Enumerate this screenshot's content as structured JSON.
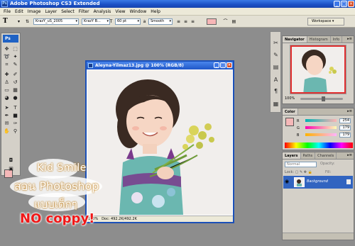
{
  "app": {
    "title": "Adobe Photoshop CS3 Extended",
    "logo": "Ps"
  },
  "menu": [
    "File",
    "Edit",
    "Image",
    "Layer",
    "Select",
    "Filter",
    "Analysis",
    "View",
    "Window",
    "Help"
  ],
  "options": {
    "tool_glyph": "T",
    "font_family": "KrazY_uS_2005",
    "font_style": "KrazY B...",
    "font_size": "60 pt",
    "antialias": "Smooth",
    "text_color": "#f7b6b6",
    "workspace_label": "Workspace"
  },
  "toolbox": {
    "badge": "Ps",
    "fg_color": "#f5b8b8"
  },
  "document": {
    "title": "Aleyna-Yilmaz13.jpg @ 100% (RGB/8)",
    "zoom": "100%",
    "doc_size": "Doc: 492.2K/492.2K"
  },
  "navigator": {
    "tabs": [
      "Navigator",
      "Histogram",
      "Info"
    ],
    "zoom": "100%"
  },
  "color_panel": {
    "tab": "Color",
    "channels": [
      {
        "label": "R",
        "value": "254"
      },
      {
        "label": "G",
        "value": "179"
      },
      {
        "label": "B",
        "value": "179"
      }
    ],
    "swatch": "#f5b8b8"
  },
  "layers_panel": {
    "tabs": [
      "Layers",
      "Paths",
      "Channels"
    ],
    "blend_mode": "Normal",
    "opacity_label": "Opacity:",
    "lock_label": "Lock:",
    "fill_label": "Fill:",
    "layer_name": "Background"
  },
  "watermark": {
    "line1": "Kid Smile",
    "line2": "สอน Photoshop",
    "line3": "แบบเด็กๆ",
    "line4": "NO coppy!"
  }
}
